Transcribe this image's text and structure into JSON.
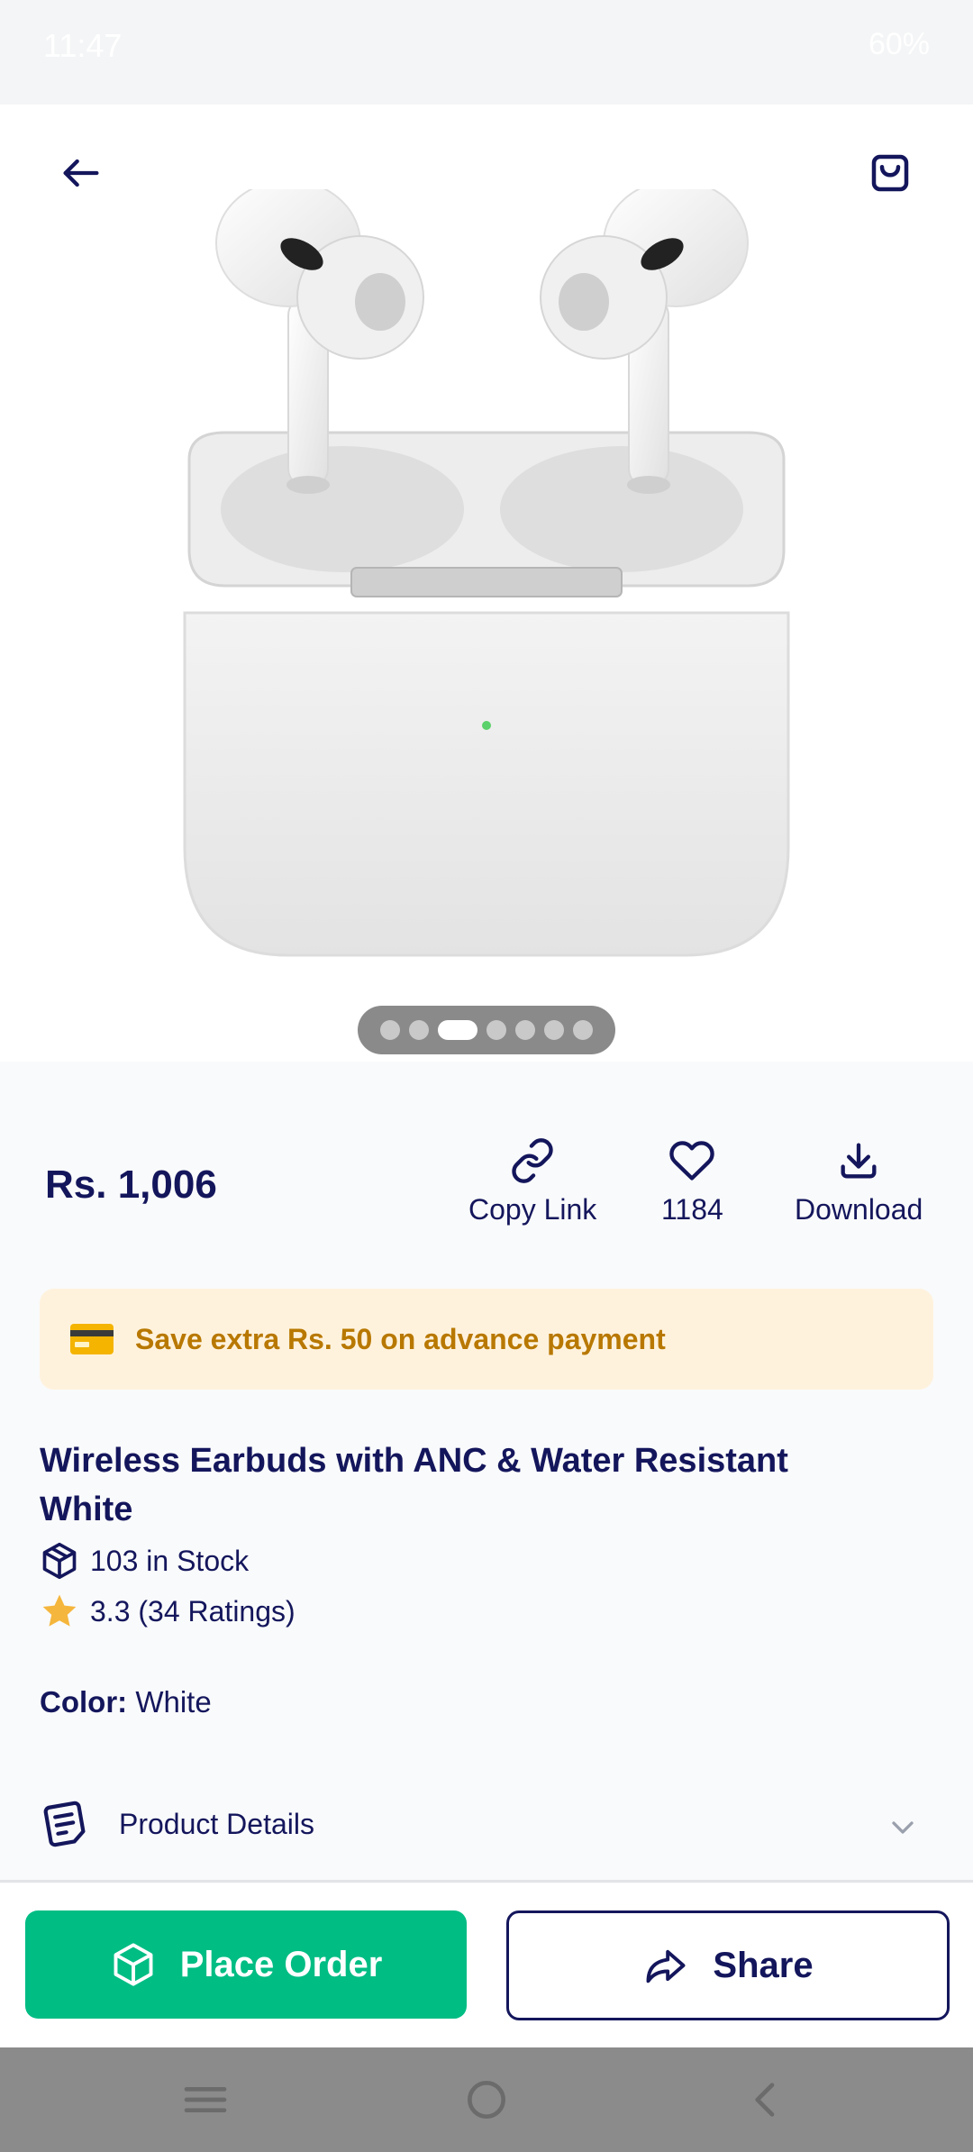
{
  "status_bar": {
    "time": "11:47",
    "right": "60%"
  },
  "header": {
    "back_icon": "arrow-left-icon",
    "bag_icon": "shopping-bag-icon"
  },
  "gallery": {
    "dots_count": 7,
    "active_index": 2
  },
  "product": {
    "price": "Rs. 1,006",
    "title": "Wireless Earbuds with ANC & Water Resistant White",
    "stock": "103 in Stock",
    "rating": "3.3 (34 Ratings)",
    "color_label": "Color:",
    "color_value": "White"
  },
  "actions": {
    "copy_link": "Copy Link",
    "likes": "1184",
    "download": "Download"
  },
  "promo": {
    "text": "Save extra Rs. 50 on advance payment"
  },
  "details": {
    "label": "Product Details"
  },
  "buttons": {
    "place_order": "Place Order",
    "share": "Share"
  },
  "colors": {
    "primary": "#14165c",
    "accent_green": "#00bd84",
    "promo_bg": "#fff2dd",
    "promo_text": "#b87800",
    "star": "#f5b63d"
  }
}
